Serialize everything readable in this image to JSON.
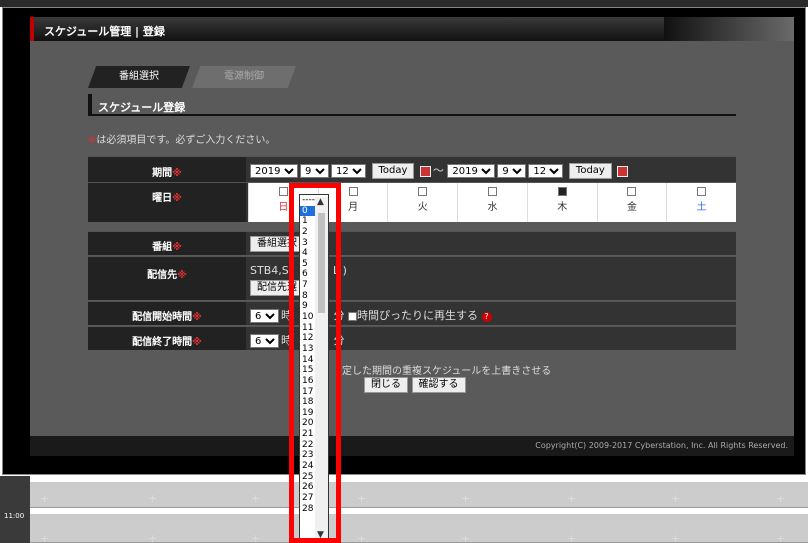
{
  "window": {
    "title": "スケジュール管理 | 登録"
  },
  "tabs": [
    {
      "label": "番組選択"
    },
    {
      "label": "電源制御"
    }
  ],
  "section": {
    "title": "スケジュール登録"
  },
  "notice": {
    "mark": "※",
    "text": "は必須項目です。必ずご入力ください。"
  },
  "required_mark": "※",
  "period": {
    "label": "期間",
    "start": {
      "year": "2019",
      "month": "9",
      "day": "12"
    },
    "separator": "～",
    "end": {
      "year": "2019",
      "month": "9",
      "day": "12"
    },
    "today_label": "Today"
  },
  "weekday": {
    "label": "曜日",
    "days": [
      {
        "label": "日",
        "checked": false
      },
      {
        "label": "月",
        "checked": false
      },
      {
        "label": "火",
        "checked": false
      },
      {
        "label": "水",
        "checked": false
      },
      {
        "label": "木",
        "checked": true
      },
      {
        "label": "金",
        "checked": false
      },
      {
        "label": "土",
        "checked": false
      }
    ]
  },
  "program": {
    "label": "番組",
    "button": "番組選択"
  },
  "destination": {
    "label": "配信先",
    "value": "STB4,St",
    "value_tail": "L )",
    "button": "配信先選"
  },
  "start_time": {
    "label": "配信開始時間",
    "hour": "6",
    "minute_prefix": "時",
    "minute_suffix": "分",
    "exact_label": "時間ぴったりに再生する"
  },
  "end_time": {
    "label": "配信終了時間",
    "hour": "6",
    "minute_prefix": "時",
    "minute_suffix": "分"
  },
  "overwrite": {
    "text": "定した期間の重複スケジュールを上書きさせる"
  },
  "actions": {
    "close": "閉じる",
    "confirm": "確認する"
  },
  "footer": {
    "copyright": "Copyright(C) 2009-2017 Cyberstation, Inc. All Rights Reserved."
  },
  "minute_dropdown": {
    "placeholder": "----",
    "selected": "0",
    "options": [
      "0",
      "1",
      "2",
      "3",
      "4",
      "5",
      "6",
      "7",
      "8",
      "9",
      "10",
      "11",
      "12",
      "13",
      "14",
      "15",
      "16",
      "17",
      "18",
      "19",
      "20",
      "21",
      "22",
      "23",
      "24",
      "25",
      "26",
      "27",
      "28"
    ]
  },
  "grid": {
    "time_label": "11:00"
  },
  "colors": {
    "required": "#e0302f",
    "accent": "#c00000",
    "highlight": "#ff0000",
    "saturday": "#3366ff"
  }
}
